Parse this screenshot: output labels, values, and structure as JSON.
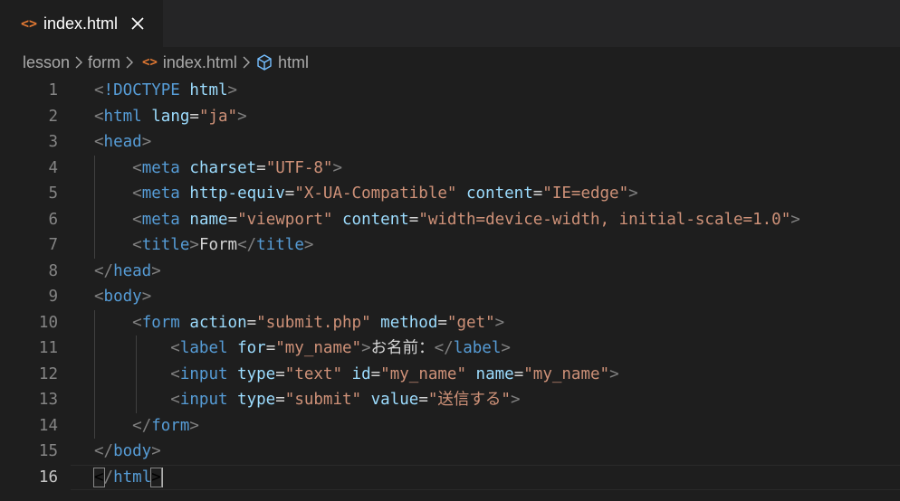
{
  "tab": {
    "label": "index.html",
    "icon": "code-icon",
    "icon_glyph": "<>",
    "close_glyph": "✕"
  },
  "breadcrumb": {
    "items": [
      "lesson",
      "form",
      "index.html",
      "html"
    ],
    "file_icon_glyph": "<>",
    "sep_icon": "chevron-right-icon",
    "element_icon": "cube-icon"
  },
  "editor": {
    "active_line": 16,
    "colors": {
      "tag": "#569cd6",
      "attr": "#9cdcfe",
      "string": "#ce9178",
      "bracket": "#808080",
      "text": "#d4d4d4"
    },
    "lines": [
      {
        "n": "1",
        "tokens": [
          [
            "b",
            "<"
          ],
          [
            "dt",
            "!DOCTYPE"
          ],
          [
            "x",
            " "
          ],
          [
            "a",
            "html"
          ],
          [
            "b",
            ">"
          ]
        ]
      },
      {
        "n": "2",
        "tokens": [
          [
            "b",
            "<"
          ],
          [
            "t",
            "html"
          ],
          [
            "x",
            " "
          ],
          [
            "a",
            "lang"
          ],
          [
            "x",
            "="
          ],
          [
            "s",
            "\"ja\""
          ],
          [
            "b",
            ">"
          ]
        ]
      },
      {
        "n": "3",
        "tokens": [
          [
            "b",
            "<"
          ],
          [
            "t",
            "head"
          ],
          [
            "b",
            ">"
          ]
        ]
      },
      {
        "n": "4",
        "tokens": [
          [
            "x",
            "    "
          ],
          [
            "b",
            "<"
          ],
          [
            "t",
            "meta"
          ],
          [
            "x",
            " "
          ],
          [
            "a",
            "charset"
          ],
          [
            "x",
            "="
          ],
          [
            "s",
            "\"UTF-8\""
          ],
          [
            "b",
            ">"
          ]
        ]
      },
      {
        "n": "5",
        "tokens": [
          [
            "x",
            "    "
          ],
          [
            "b",
            "<"
          ],
          [
            "t",
            "meta"
          ],
          [
            "x",
            " "
          ],
          [
            "a",
            "http-equiv"
          ],
          [
            "x",
            "="
          ],
          [
            "s",
            "\"X-UA-Compatible\""
          ],
          [
            "x",
            " "
          ],
          [
            "a",
            "content"
          ],
          [
            "x",
            "="
          ],
          [
            "s",
            "\"IE=edge\""
          ],
          [
            "b",
            ">"
          ]
        ]
      },
      {
        "n": "6",
        "tokens": [
          [
            "x",
            "    "
          ],
          [
            "b",
            "<"
          ],
          [
            "t",
            "meta"
          ],
          [
            "x",
            " "
          ],
          [
            "a",
            "name"
          ],
          [
            "x",
            "="
          ],
          [
            "s",
            "\"viewport\""
          ],
          [
            "x",
            " "
          ],
          [
            "a",
            "content"
          ],
          [
            "x",
            "="
          ],
          [
            "s",
            "\"width=device-width, initial-scale=1.0\""
          ],
          [
            "b",
            ">"
          ]
        ]
      },
      {
        "n": "7",
        "tokens": [
          [
            "x",
            "    "
          ],
          [
            "b",
            "<"
          ],
          [
            "t",
            "title"
          ],
          [
            "b",
            ">"
          ],
          [
            "x",
            "Form"
          ],
          [
            "b",
            "</"
          ],
          [
            "t",
            "title"
          ],
          [
            "b",
            ">"
          ]
        ]
      },
      {
        "n": "8",
        "tokens": [
          [
            "b",
            "</"
          ],
          [
            "t",
            "head"
          ],
          [
            "b",
            ">"
          ]
        ]
      },
      {
        "n": "9",
        "tokens": [
          [
            "b",
            "<"
          ],
          [
            "t",
            "body"
          ],
          [
            "b",
            ">"
          ]
        ]
      },
      {
        "n": "10",
        "tokens": [
          [
            "x",
            "    "
          ],
          [
            "b",
            "<"
          ],
          [
            "t",
            "form"
          ],
          [
            "x",
            " "
          ],
          [
            "a",
            "action"
          ],
          [
            "x",
            "="
          ],
          [
            "s",
            "\"submit.php\""
          ],
          [
            "x",
            " "
          ],
          [
            "a",
            "method"
          ],
          [
            "x",
            "="
          ],
          [
            "s",
            "\"get\""
          ],
          [
            "b",
            ">"
          ]
        ]
      },
      {
        "n": "11",
        "tokens": [
          [
            "x",
            "        "
          ],
          [
            "b",
            "<"
          ],
          [
            "t",
            "label"
          ],
          [
            "x",
            " "
          ],
          [
            "a",
            "for"
          ],
          [
            "x",
            "="
          ],
          [
            "s",
            "\"my_name\""
          ],
          [
            "b",
            ">"
          ],
          [
            "x",
            "お名前："
          ],
          [
            "b",
            "</"
          ],
          [
            "t",
            "label"
          ],
          [
            "b",
            ">"
          ]
        ]
      },
      {
        "n": "12",
        "tokens": [
          [
            "x",
            "        "
          ],
          [
            "b",
            "<"
          ],
          [
            "t",
            "input"
          ],
          [
            "x",
            " "
          ],
          [
            "a",
            "type"
          ],
          [
            "x",
            "="
          ],
          [
            "s",
            "\"text\""
          ],
          [
            "x",
            " "
          ],
          [
            "a",
            "id"
          ],
          [
            "x",
            "="
          ],
          [
            "s",
            "\"my_name\""
          ],
          [
            "x",
            " "
          ],
          [
            "a",
            "name"
          ],
          [
            "x",
            "="
          ],
          [
            "s",
            "\"my_name\""
          ],
          [
            "b",
            ">"
          ]
        ]
      },
      {
        "n": "13",
        "tokens": [
          [
            "x",
            "        "
          ],
          [
            "b",
            "<"
          ],
          [
            "t",
            "input"
          ],
          [
            "x",
            " "
          ],
          [
            "a",
            "type"
          ],
          [
            "x",
            "="
          ],
          [
            "s",
            "\"submit\""
          ],
          [
            "x",
            " "
          ],
          [
            "a",
            "value"
          ],
          [
            "x",
            "="
          ],
          [
            "s",
            "\"送信する\""
          ],
          [
            "b",
            ">"
          ]
        ]
      },
      {
        "n": "14",
        "tokens": [
          [
            "x",
            "    "
          ],
          [
            "b",
            "</"
          ],
          [
            "t",
            "form"
          ],
          [
            "b",
            ">"
          ]
        ]
      },
      {
        "n": "15",
        "tokens": [
          [
            "b",
            "</"
          ],
          [
            "t",
            "body"
          ],
          [
            "b",
            ">"
          ]
        ]
      },
      {
        "n": "16",
        "tokens": [
          [
            "bm",
            "<"
          ],
          [
            "b",
            "/"
          ],
          [
            "t",
            "html"
          ],
          [
            "bm",
            ">"
          ]
        ]
      }
    ]
  }
}
